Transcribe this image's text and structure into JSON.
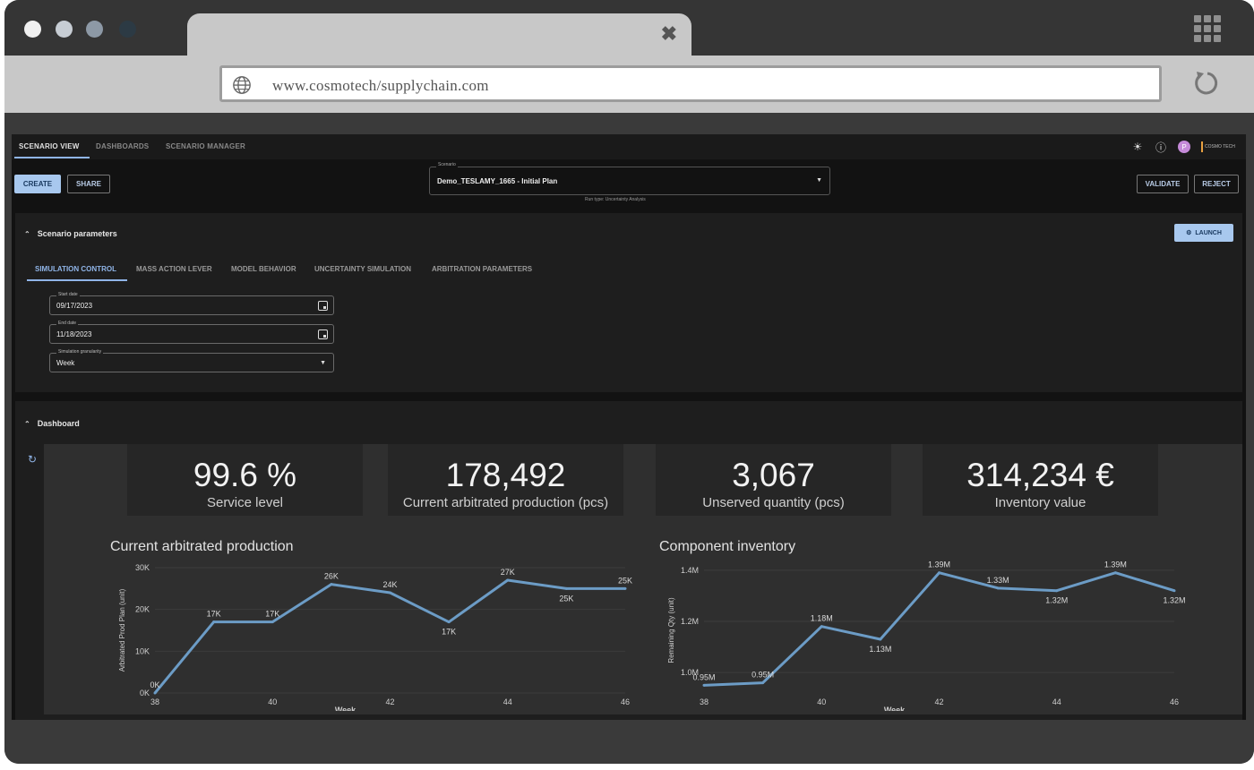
{
  "browser": {
    "url": "www.cosmotech/supplychain.com",
    "dot_colors": [
      "#f0f0f0",
      "#c7cdd4",
      "#8d99a6",
      "#2c3a44"
    ]
  },
  "nav": {
    "tabs": [
      "SCENARIO VIEW",
      "DASHBOARDS",
      "SCENARIO MANAGER"
    ],
    "avatar_initial": "P",
    "logo_text": "COSMO TECH"
  },
  "toolbar": {
    "create_label": "CREATE",
    "share_label": "SHARE",
    "validate_label": "VALIDATE",
    "reject_label": "REJECT"
  },
  "scenario": {
    "label": "Scenario",
    "value": "Demo_TESLAMY_1665 - Initial Plan",
    "run_type": "Run type: Uncertainty Analysis"
  },
  "parameters": {
    "title": "Scenario parameters",
    "launch_label": "LAUNCH",
    "tabs": [
      "SIMULATION CONTROL",
      "MASS ACTION LEVER",
      "MODEL BEHAVIOR",
      "UNCERTAINTY SIMULATION",
      "ARBITRATION PARAMETERS"
    ],
    "fields": [
      {
        "label": "Start date",
        "value": "09/17/2023"
      },
      {
        "label": "End date",
        "value": "11/18/2023"
      },
      {
        "label": "Simulation granularity",
        "value": "Week"
      }
    ]
  },
  "dashboard": {
    "title": "Dashboard",
    "kpis": [
      {
        "value": "99.6 %",
        "label": "Service level"
      },
      {
        "value": "178,492",
        "label": "Current arbitrated production (pcs)"
      },
      {
        "value": "3,067",
        "label": "Unserved quantity (pcs)"
      },
      {
        "value": "314,234 €",
        "label": "Inventory value"
      }
    ]
  },
  "chart_data": [
    {
      "type": "line",
      "title": "Current arbitrated production",
      "xlabel": "Week",
      "ylabel": "Arbitrated Prod Plan (unit)",
      "x": [
        38,
        39,
        40,
        41,
        42,
        43,
        44,
        45,
        46
      ],
      "values": [
        0,
        17,
        17,
        26,
        24,
        17,
        27,
        25,
        25
      ],
      "data_labels": [
        "0K",
        "17K",
        "17K",
        "26K",
        "24K",
        "17K",
        "27K",
        "25K",
        "25K"
      ],
      "x_ticks": [
        "38",
        "40",
        "42",
        "44",
        "46"
      ],
      "y_ticks": [
        "0K",
        "10K",
        "20K",
        "30K"
      ],
      "ylim": [
        0,
        30
      ],
      "line_color": "#6c9cc6"
    },
    {
      "type": "line",
      "title": "Component inventory",
      "xlabel": "Week",
      "ylabel": "Remaining Qty (unit)",
      "x": [
        38,
        39,
        40,
        41,
        42,
        43,
        44,
        45,
        46
      ],
      "values": [
        0.95,
        0.96,
        1.18,
        1.13,
        1.39,
        1.33,
        1.32,
        1.39,
        1.32
      ],
      "data_labels": [
        "0.95M",
        "0.95M",
        "1.18M",
        "1.13M",
        "1.39M",
        "1.33M",
        "1.32M",
        "1.39M",
        "1.32M"
      ],
      "x_ticks": [
        "38",
        "40",
        "42",
        "44",
        "46"
      ],
      "y_ticks": [
        "1.0M",
        "1.2M",
        "1.4M"
      ],
      "ylim": [
        0.92,
        1.41
      ],
      "line_color": "#6c9cc6"
    }
  ]
}
